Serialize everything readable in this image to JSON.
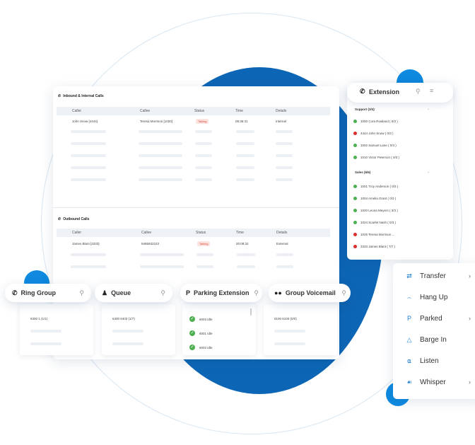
{
  "calls": {
    "inbound": {
      "title": "Inbound & Internal Calls",
      "columns": [
        "Caller",
        "Callee",
        "Status",
        "Time",
        "Details"
      ],
      "row": {
        "caller": "John Snow [4444]",
        "callee": "Teresa Morrison [1020]",
        "status": "Talking",
        "time": "08:36:31",
        "details": "Internal"
      }
    },
    "outbound": {
      "title": "Outbound Calls",
      "columns": [
        "Caller",
        "Callee",
        "Status",
        "Time",
        "Details"
      ],
      "row": {
        "caller": "James Blant [3333]",
        "callee": "9495932223",
        "status": "Talking",
        "time": "00:08:32",
        "details": "External"
      }
    }
  },
  "extension": {
    "title": "Extension",
    "groups": [
      {
        "name": "Support (3/4)",
        "items": [
          {
            "label": "1000 Cora Rowland ( 0/3 )",
            "status": "available"
          },
          {
            "label": "4444 John Snow ( 0/3 )",
            "status": "busy"
          },
          {
            "label": "1002 Samuel Lane ( 0/3 )",
            "status": "available"
          },
          {
            "label": "1010 Victor Peterson ( 0/3 )",
            "status": "available"
          }
        ]
      },
      {
        "name": "Sales (6/6)",
        "items": [
          {
            "label": "1001 Troy Anderson ( 0/3 )",
            "status": "available"
          },
          {
            "label": "1004 Amelia Grant ( 0/3 )",
            "status": "available"
          },
          {
            "label": "1020 Leona Meyers ( 3/3 )",
            "status": "available"
          },
          {
            "label": "1024 Scarlet Nash ( 0/3 )",
            "status": "available"
          },
          {
            "label": "1025 Teresa Morrison ...",
            "status": "busy"
          },
          {
            "label": "3333 James Blant ( 7/7 )",
            "status": "busy"
          }
        ]
      }
    ]
  },
  "panels": {
    "ring_group": {
      "label": "Ring Group",
      "value": "6300 1 (1/1)"
    },
    "queue": {
      "label": "Queue",
      "value": "6400 6403 (1/7)"
    },
    "parking": {
      "label": "Parking Extension",
      "slots": [
        "6003 Idle",
        "6001 Idle",
        "6002 Idle"
      ]
    },
    "group_voicemail": {
      "label": "Group Voicemail",
      "value": "6100 6100 (0/0)"
    }
  },
  "call_menu": {
    "items": [
      {
        "label": "Transfer",
        "icon": "transfer-icon",
        "has_submenu": true
      },
      {
        "label": "Hang Up",
        "icon": "hang-up-icon",
        "has_submenu": false
      },
      {
        "label": "Parked",
        "icon": "parked-icon",
        "has_submenu": true
      },
      {
        "label": "Barge In",
        "icon": "barge-in-icon",
        "has_submenu": false
      },
      {
        "label": "Listen",
        "icon": "headphones-icon",
        "has_submenu": false
      },
      {
        "label": "Whisper",
        "icon": "whisper-icon",
        "has_submenu": true
      }
    ]
  },
  "colors": {
    "accent": "#0d66b5",
    "available": "#4caf50",
    "busy": "#d9302c",
    "talking_badge": "#fde3df"
  }
}
